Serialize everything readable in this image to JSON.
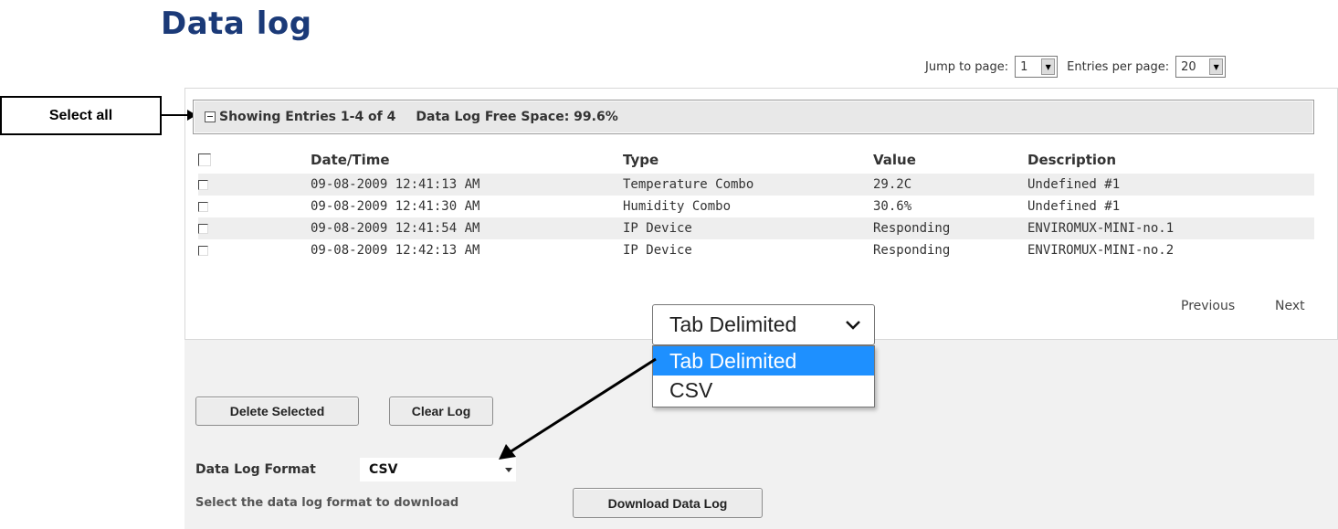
{
  "page_title": "Data log",
  "pager": {
    "jump_label": "Jump to page:",
    "jump_value": "1",
    "entries_label": "Entries per page:",
    "entries_value": "20"
  },
  "callout": {
    "label": "Select all"
  },
  "header": {
    "showing": "Showing Entries 1-4 of 4",
    "free_space": "Data Log Free Space: 99.6%"
  },
  "table": {
    "columns": [
      "Date/Time",
      "Type",
      "Value",
      "Description"
    ],
    "rows": [
      {
        "datetime": "09-08-2009 12:41:13 AM",
        "type": "Temperature Combo",
        "value": "29.2C",
        "description": "Undefined #1"
      },
      {
        "datetime": "09-08-2009 12:41:30 AM",
        "type": "Humidity Combo",
        "value": "30.6%",
        "description": "Undefined #1"
      },
      {
        "datetime": "09-08-2009 12:41:54 AM",
        "type": "IP Device",
        "value": "Responding",
        "description": "ENVIROMUX-MINI-no.1"
      },
      {
        "datetime": "09-08-2009 12:42:13 AM",
        "type": "IP Device",
        "value": "Responding",
        "description": "ENVIROMUX-MINI-no.2"
      }
    ]
  },
  "pagination": {
    "previous": "Previous",
    "next": "Next"
  },
  "dropdown_popup": {
    "selected": "Tab Delimited",
    "options": [
      "Tab Delimited",
      "CSV"
    ],
    "highlight_color": "#1e90ff"
  },
  "buttons": {
    "delete_selected": "Delete Selected",
    "clear_log": "Clear Log",
    "download": "Download Data Log"
  },
  "format": {
    "label": "Data Log Format",
    "value": "CSV",
    "hint": "Select the data log format to download"
  },
  "colors": {
    "title": "#1b3a78",
    "panel_bg": "#f1f1f1"
  }
}
